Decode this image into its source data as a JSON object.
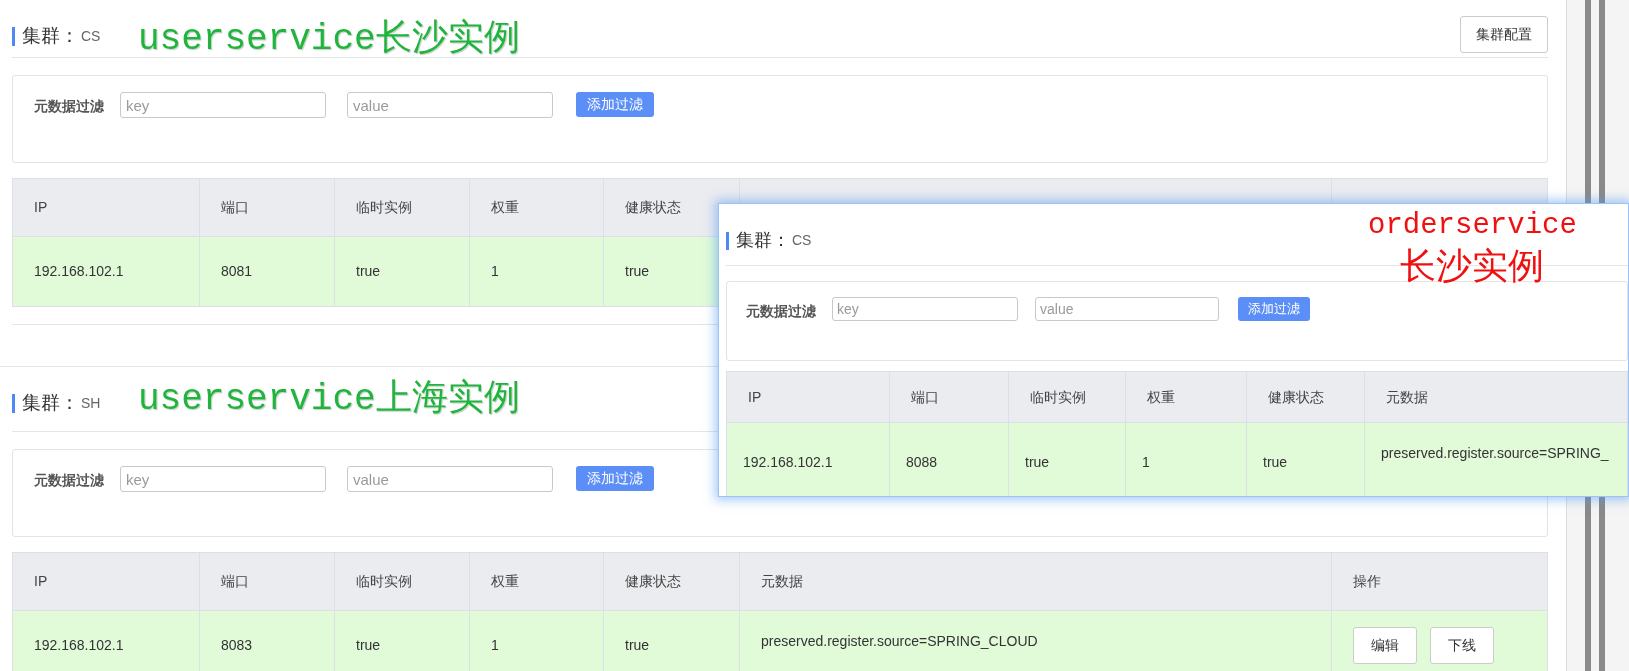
{
  "clusters": [
    {
      "label": "集群：",
      "name": "CS",
      "annotation": "userservice长沙实例",
      "config_button": "集群配置",
      "filter": {
        "label": "元数据过滤",
        "key_placeholder": "key",
        "value_placeholder": "value",
        "button": "添加过滤"
      },
      "table": {
        "columns": [
          "IP",
          "端口",
          "临时实例",
          "权重",
          "健康状态"
        ],
        "rows": [
          {
            "cells": [
              "192.168.102.1",
              "8081",
              "true",
              "1",
              "true"
            ],
            "actions": []
          }
        ]
      }
    },
    {
      "label": "集群：",
      "name": "SH",
      "annotation": "userservice上海实例",
      "filter": {
        "label": "元数据过滤",
        "key_placeholder": "key",
        "value_placeholder": "value",
        "button": "添加过滤"
      },
      "table": {
        "columns": [
          "IP",
          "端口",
          "临时实例",
          "权重",
          "健康状态",
          "元数据",
          "操作"
        ],
        "rows": [
          {
            "cells": [
              "192.168.102.1",
              "8083",
              "true",
              "1",
              "true",
              "preserved.register.source=SPRING_CLOUD"
            ],
            "actions": [
              "编辑",
              "下线"
            ]
          }
        ]
      }
    }
  ],
  "overlay": {
    "label": "集群：",
    "name": "CS",
    "annotation": [
      "orderservice",
      "长沙实例"
    ],
    "filter": {
      "label": "元数据过滤",
      "key_placeholder": "key",
      "value_placeholder": "value",
      "button": "添加过滤"
    },
    "table": {
      "columns": [
        "IP",
        "端口",
        "临时实例",
        "权重",
        "健康状态",
        "元数据"
      ],
      "rows": [
        {
          "cells": [
            "192.168.102.1",
            "8088",
            "true",
            "1",
            "true",
            "preserved.register.source=SPRING_"
          ]
        }
      ]
    }
  }
}
